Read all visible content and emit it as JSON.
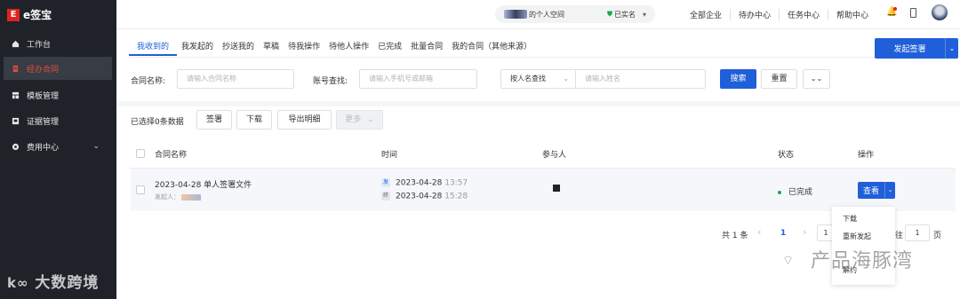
{
  "brand": {
    "logo_mark": "E",
    "name": "e签宝"
  },
  "sidebar": {
    "items": [
      {
        "label": "工作台",
        "icon": "home-icon"
      },
      {
        "label": "经办合同",
        "icon": "document-icon",
        "active": true
      },
      {
        "label": "模板管理",
        "icon": "template-icon"
      },
      {
        "label": "证据管理",
        "icon": "evidence-icon"
      },
      {
        "label": "费用中心",
        "icon": "cost-icon",
        "expandable": true
      }
    ],
    "chevron": "⌄"
  },
  "topbar": {
    "space_name": "的个人空间",
    "verified": "已实名",
    "links": [
      "全部企业",
      "待办中心",
      "任务中心",
      "帮助中心"
    ]
  },
  "tabs": [
    "我收到的",
    "我发起的",
    "抄送我的",
    "草稿",
    "待我操作",
    "待他人操作",
    "已完成",
    "批量合同",
    "我的合同（其他来源）"
  ],
  "primary_button": {
    "label": "发起签署",
    "arrow": "⌄"
  },
  "filters": {
    "contract_name_label": "合同名称:",
    "contract_name_placeholder": "请输入合同名称",
    "account_label": "账号查找:",
    "account_placeholder": "请输入手机号或邮箱",
    "by_name_select": "按人名查找",
    "name_placeholder": "请输入姓名",
    "search_button": "搜索",
    "reset_button": "重置",
    "expand_icon": "⌄⌄"
  },
  "actions": {
    "selected_info": "已选择0条数据",
    "sign": "签署",
    "download": "下载",
    "export": "导出明细",
    "more": "更多"
  },
  "table": {
    "columns": [
      "合同名称",
      "时间",
      "参与人",
      "状态",
      "操作"
    ],
    "rows": [
      {
        "name": "2023-04-28 单人签署文件",
        "initiator_label": "发起人：",
        "start_tag": "发",
        "start_date": "2023-04-28",
        "start_time": "13:57",
        "end_tag": "终",
        "end_date": "2023-04-28",
        "end_time": "15:28",
        "status": "已完成",
        "action": "查看"
      }
    ]
  },
  "row_menu": [
    "下载",
    "重新发起",
    "解约"
  ],
  "pagination": {
    "total": "共 1 条",
    "prev": "‹",
    "current": "1",
    "next": "›",
    "goto_prefix": "往",
    "goto_value": "1",
    "goto_suffix": "页"
  },
  "watermarks": {
    "left": "大数跨境",
    "right": "产品海豚湾"
  }
}
